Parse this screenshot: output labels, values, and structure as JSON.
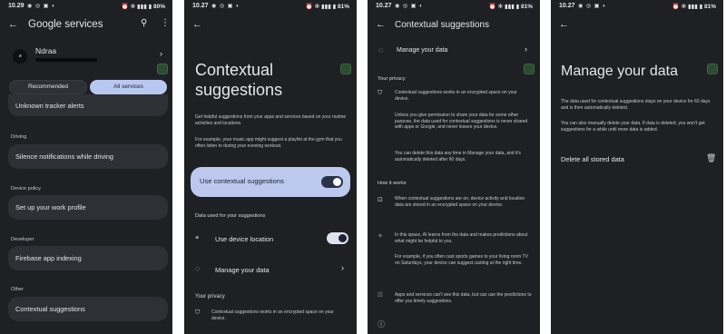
{
  "status": {
    "p1": {
      "time": "10.29",
      "battery": "80%"
    },
    "p2": {
      "time": "10.27",
      "battery": "81%"
    },
    "p3": {
      "time": "10.27",
      "battery": "81%"
    },
    "p4": {
      "time": "10.27",
      "battery": "81%"
    }
  },
  "screen1": {
    "title": "Google services",
    "account_name": "Ndraa",
    "tabs": {
      "recommended": "Recommended",
      "all": "All services"
    },
    "items": {
      "tracker": "Unknown tracker alerts",
      "driving_cat": "Driving",
      "driving": "Silence notifications while driving",
      "device_policy_cat": "Device policy",
      "work_profile": "Set up your work profile",
      "developer_cat": "Developer",
      "firebase": "Firebase app indexing",
      "other_cat": "Other",
      "contextual": "Contextual suggestions"
    }
  },
  "screen2": {
    "title": "Contextual suggestions",
    "intro1": "Get helpful suggestions from your apps and services based on your routine activities and locations.",
    "intro2": "For example, your music app might suggest a playlist at the gym that you often listen to during your evening workout.",
    "main_toggle": "Use contextual suggestions",
    "data_section": "Data used for your suggestions",
    "location": "Use device location",
    "manage": "Manage your data",
    "privacy_title": "Your privacy",
    "privacy_text": "Contextual suggestions works in an encrypted space on your device."
  },
  "screen3": {
    "title": "Contextual suggestions",
    "manage": "Manage your data",
    "privacy_title": "Your privacy",
    "privacy1": "Contextual suggestions works in an encrypted space on your device.",
    "privacy2": "Unless you give permission to share your data for some other purpose, the data used for contextual suggestions is never shared with apps or Google, and never leaves your device.",
    "privacy3": "You can delete this data any time in Manage your data, and it's automatically deleted after 60 days.",
    "how_title": "How it works",
    "how1": "When contextual suggestions are on, device activity and location data are stored in an encrypted space on your device.",
    "how2": "In this space, AI learns from the data and makes predictions about what might be helpful to you.",
    "how3": "For example, if you often cast sports games to your living room TV on Saturdays, your device can suggest casting at the right time.",
    "how4": "Apps and services can't see this data, but can use the predictions to offer you timely suggestions."
  },
  "screen4": {
    "title": "Manage your data",
    "text1": "The data used for contextual suggestions stays on your device for 60 days and is then automatically deleted.",
    "text2": "You can also manually delete your data. If data is deleted, you won't get suggestions for a while until more data is added.",
    "delete": "Delete all stored data"
  },
  "icons": {
    "back": "arrow-left",
    "search": "magnifier",
    "more": "vertical-dots",
    "chevron": "chevron-right",
    "location": "pin",
    "manage": "circle-progress",
    "shield": "shield",
    "lock": "lock",
    "sparkle": "sparkle",
    "grid": "dots-grid",
    "trash": "trash",
    "info": "info"
  },
  "colors": {
    "background": "#1f2024",
    "card": "#2e3035",
    "accent_tab": "#b9c8f0",
    "toggle_card": "#bcc8ee",
    "text": "#e6e6ea"
  }
}
